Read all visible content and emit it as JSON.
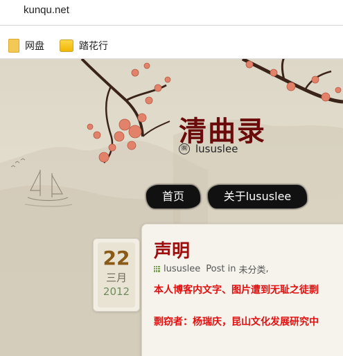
{
  "browser": {
    "url": "kunqu.net",
    "bookmarks": [
      {
        "label": "网盘",
        "icon": "folder-icon"
      },
      {
        "label": "踏花行",
        "icon": "page-icon"
      }
    ]
  },
  "site": {
    "title": "清曲录",
    "author_icon_glyph": "㈱",
    "author": "lususlee",
    "nav": [
      "首页",
      "关于lususlee"
    ]
  },
  "post": {
    "date": {
      "day": "22",
      "month": "三月",
      "year": "2012"
    },
    "title": "声明",
    "meta": {
      "author": "lususlee",
      "post_in": "Post in",
      "category": "未分类",
      "separator": ","
    },
    "body": [
      "本人博客内文字、图片遭到无耻之徒剽",
      "剽窃者：杨瑞庆，昆山文化发展研究中"
    ]
  },
  "colors": {
    "title": "#6b0a0a",
    "post_title": "#9c0e0e",
    "body_text": "#e01010",
    "nav_ink": "#111111",
    "date_day": "#8a5a17",
    "date_year": "#6f8c5e"
  }
}
